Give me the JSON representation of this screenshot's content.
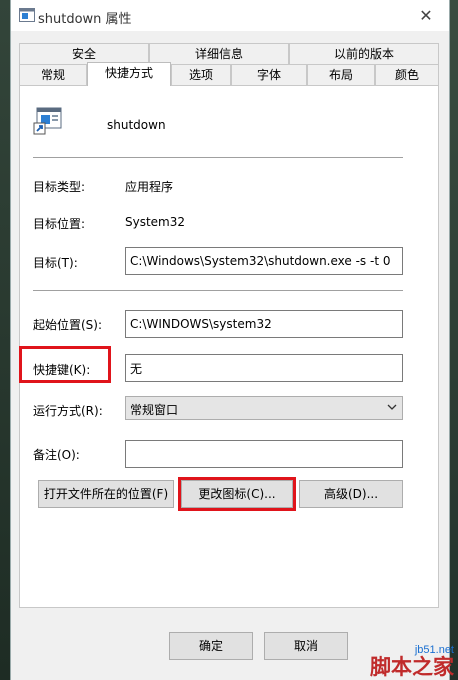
{
  "window": {
    "title": "shutdown 属性"
  },
  "tabs_row_top": [
    "安全",
    "详细信息",
    "以前的版本"
  ],
  "tabs_row_bottom": [
    "常规",
    "快捷方式",
    "选项",
    "字体",
    "布局",
    "颜色"
  ],
  "active_tab": "快捷方式",
  "app_name": "shutdown",
  "fields": {
    "target_type_label": "目标类型:",
    "target_type_value": "应用程序",
    "target_location_label": "目标位置:",
    "target_location_value": "System32",
    "target_label": "目标(T):",
    "target_value": "C:\\Windows\\System32\\shutdown.exe -s -t 0",
    "start_in_label": "起始位置(S):",
    "start_in_value": "C:\\WINDOWS\\system32",
    "hotkey_label": "快捷键(K):",
    "hotkey_value": "无",
    "run_label": "运行方式(R):",
    "run_value": "常规窗口",
    "comment_label": "备注(O):",
    "comment_value": ""
  },
  "buttons": {
    "open_location": "打开文件所在的位置(F)",
    "change_icon": "更改图标(C)...",
    "advanced": "高级(D)...",
    "ok": "确定",
    "cancel": "取消"
  },
  "watermark": {
    "url": "jb51.net",
    "site": "脚本之家"
  },
  "colors": {
    "highlight": "#e0141b",
    "window_bg": "#f0f0f0",
    "panel_bg": "#ffffff"
  }
}
